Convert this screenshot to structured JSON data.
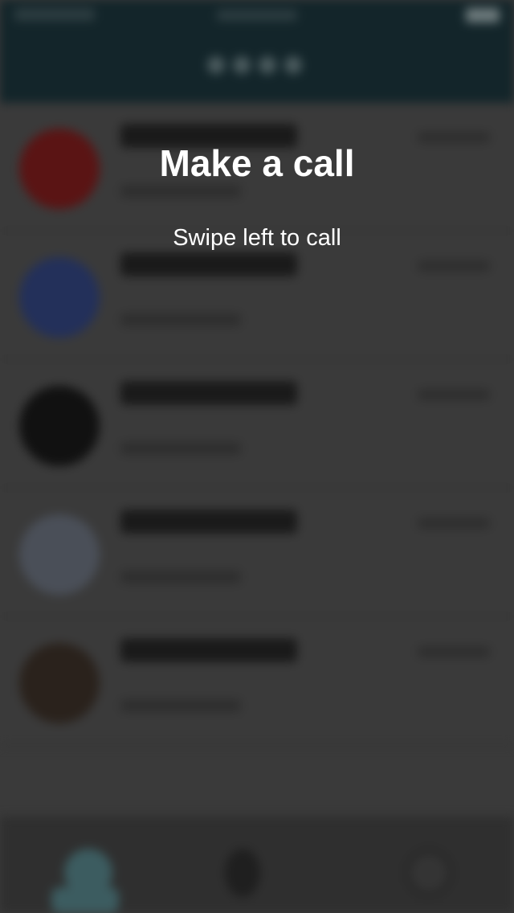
{
  "overlay": {
    "title": "Make a call",
    "subtitle": "Swipe left to call"
  },
  "colors": {
    "header": "#13252a",
    "list_background": "#3a3a3a",
    "overlay_text": "#ffffff",
    "tab_active": "#3c5c60"
  },
  "contacts": [
    {
      "avatar_icon": "heart-avatar-icon",
      "avatar_color": "#5a1414"
    },
    {
      "avatar_icon": "colorful-avatar-icon",
      "avatar_color": "#23305a"
    },
    {
      "avatar_icon": "dark-avatar-icon",
      "avatar_color": "#111111"
    },
    {
      "avatar_icon": "light-avatar-icon",
      "avatar_color": "#4a4f58"
    },
    {
      "avatar_icon": "colorful-avatar-icon",
      "avatar_color": "#2a221c"
    }
  ],
  "tabs": [
    {
      "icon": "chats-tab-icon"
    },
    {
      "icon": "calls-tab-icon"
    },
    {
      "icon": "settings-tab-icon"
    }
  ]
}
